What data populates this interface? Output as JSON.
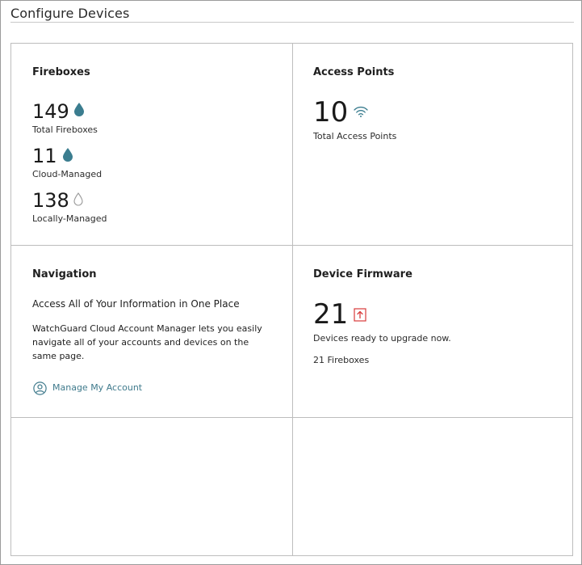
{
  "page": {
    "title": "Configure Devices"
  },
  "fireboxes": {
    "title": "Fireboxes",
    "total": {
      "value": "149",
      "label": "Total Fireboxes",
      "icon": "droplet-filled-icon"
    },
    "cloud": {
      "value": "11",
      "label": "Cloud-Managed",
      "icon": "droplet-filled-icon"
    },
    "local": {
      "value": "138",
      "label": "Locally-Managed",
      "icon": "droplet-outline-icon"
    }
  },
  "access_points": {
    "title": "Access Points",
    "total": {
      "value": "10",
      "label": "Total Access Points",
      "icon": "wifi-icon"
    }
  },
  "navigation": {
    "title": "Navigation",
    "heading": "Access All of Your Information in One Place",
    "body": "WatchGuard Cloud Account Manager lets you easily navigate all of your accounts and devices on the same page.",
    "link_label": "Manage My Account",
    "link_icon": "user-circle-icon"
  },
  "firmware": {
    "title": "Device Firmware",
    "count": "21",
    "icon": "upgrade-arrow-icon",
    "status": "Devices ready to upgrade now.",
    "detail": "21 Fireboxes"
  },
  "colors": {
    "accent_teal": "#3b7d8f",
    "icon_gray": "#9a9a9a",
    "upgrade_red": "#d93b3b",
    "link": "#3f7a8c",
    "border": "#bdbdbd"
  }
}
